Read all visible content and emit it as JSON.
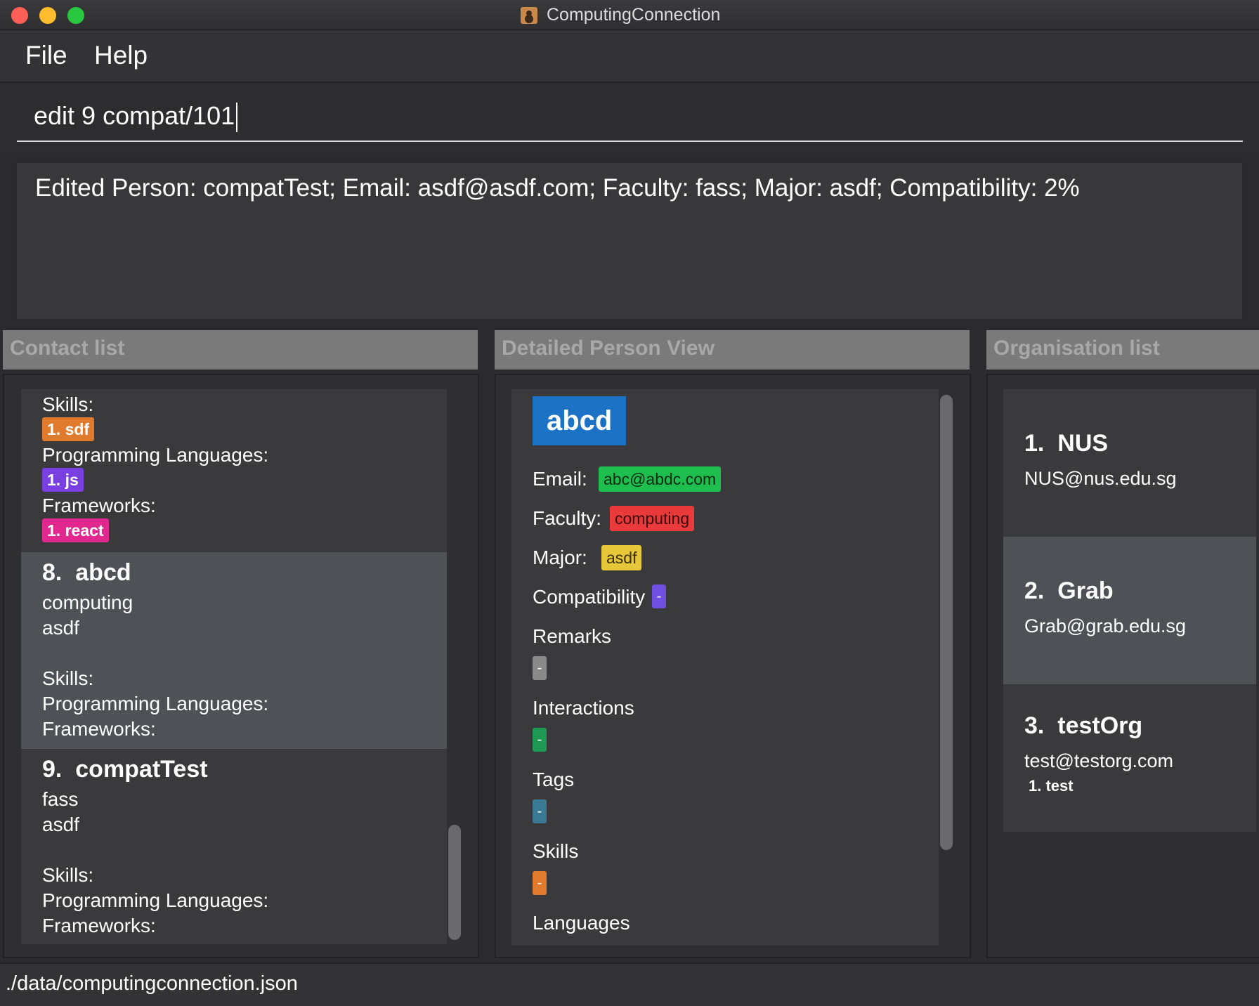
{
  "window": {
    "title": "ComputingConnection"
  },
  "menu": {
    "file": "File",
    "help": "Help"
  },
  "command": {
    "value": "edit 9 compat/101"
  },
  "result": {
    "text": "Edited Person: compatTest; Email: asdf@asdf.com; Faculty: fass; Major: asdf; Compatibility: 2%"
  },
  "panels": {
    "contact_list": "Contact list",
    "detail_view": "Detailed Person View",
    "org_list": "Organisation list"
  },
  "contacts": {
    "partial": {
      "skills_label": "Skills:",
      "skill_1": "1. sdf",
      "pl_label": "Programming Languages:",
      "pl_1": "1. js",
      "fw_label": "Frameworks:",
      "fw_1": "1. react"
    },
    "c8": {
      "index": "8.",
      "name": "abcd",
      "faculty": "computing",
      "major": "asdf",
      "skills_label": "Skills:",
      "pl_label": "Programming Languages:",
      "fw_label": "Frameworks:"
    },
    "c9": {
      "index": "9.",
      "name": "compatTest",
      "faculty": "fass",
      "major": "asdf",
      "skills_label": "Skills:",
      "pl_label": "Programming Languages:",
      "fw_label": "Frameworks:"
    }
  },
  "detail": {
    "name": "abcd",
    "email_label": "Email:",
    "email": "abc@abdc.com",
    "faculty_label": "Faculty:",
    "faculty": "computing",
    "major_label": "Major:",
    "major": "asdf",
    "compat_label": "Compatibility",
    "compat": "-",
    "remarks_label": "Remarks",
    "remarks": "-",
    "interactions_label": "Interactions",
    "interactions": "-",
    "tags_label": "Tags",
    "tags": "-",
    "skills_label": "Skills",
    "skills": "-",
    "languages_label": "Languages"
  },
  "orgs": [
    {
      "index": "1.",
      "name": "NUS",
      "email": "NUS@nus.edu.sg"
    },
    {
      "index": "2.",
      "name": "Grab",
      "email": "Grab@grab.edu.sg"
    },
    {
      "index": "3.",
      "name": "testOrg",
      "email": "test@testorg.com",
      "tag": "1. test"
    }
  ],
  "status": {
    "path": "./data/computingconnection.json"
  },
  "colors": {
    "skill": "#e07b2e",
    "language": "#7a3fe0",
    "framework": "#e0288f",
    "email": "#1fbf4f",
    "faculty": "#e83a3a",
    "major": "#e6c73a",
    "compat": "#6f4fe0",
    "remarks": "#8a8a8a",
    "interactions": "#1f9a55",
    "tags": "#3a7a94",
    "name_badge": "#1c73c5"
  }
}
